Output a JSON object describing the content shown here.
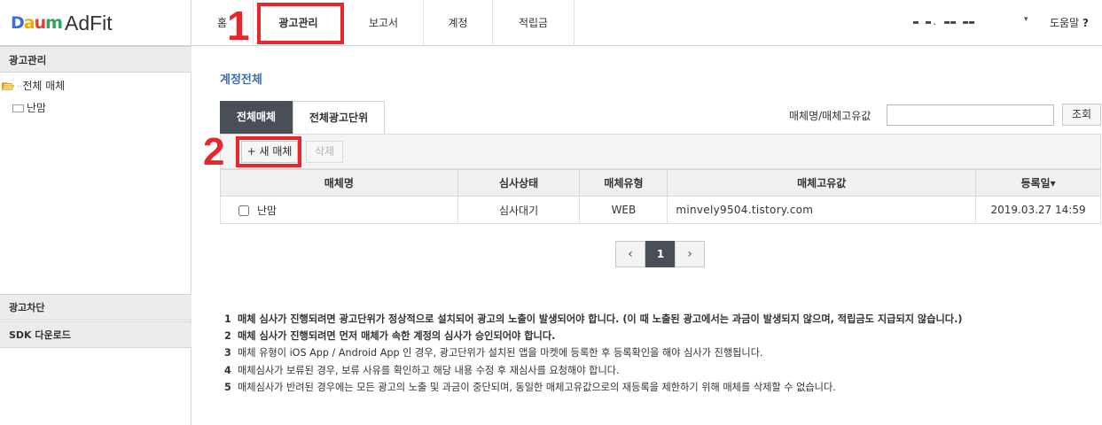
{
  "brand": {
    "daum_letters": [
      "D",
      "a",
      "u",
      "m"
    ],
    "daum_colors": [
      "#3d6fd8",
      "#f4a700",
      "#e33e2b",
      "#2da55b"
    ],
    "adfit": "AdFit"
  },
  "nav": {
    "items": [
      "홈",
      "광고관리",
      "보고서",
      "계정",
      "적립금"
    ],
    "active": "광고관리"
  },
  "user": {
    "name_masked": "▬ ▬. ▬▬ ▬▬",
    "caret": "▾"
  },
  "help": {
    "label": "도움말",
    "icon": "?"
  },
  "annotations": {
    "step1": "1",
    "step2": "2",
    "mark_color": "#e8262b"
  },
  "sidebar": {
    "section_title": "광고관리",
    "tree": [
      {
        "label": "전체 매체",
        "icon": "open-folder-icon"
      },
      {
        "label": "난맘",
        "icon": "folder-icon"
      }
    ],
    "bottom_sections": [
      "광고차단",
      "SDK 다운로드"
    ]
  },
  "main": {
    "title": "계정전체",
    "tabs": [
      "전체매체",
      "전체광고단위"
    ],
    "search": {
      "label": "매체명/매체고유값",
      "value": "",
      "button": "조회"
    },
    "toolbar": {
      "new_button": "+ 새 매체",
      "delete_button": "삭제"
    },
    "table": {
      "columns": [
        "매체명",
        "심사상태",
        "매체유형",
        "매체고유값",
        "등록일▾"
      ],
      "rows": [
        {
          "name": "난맘",
          "status": "심사대기",
          "type": "WEB",
          "id": "minvely9504.tistory.com",
          "date": "2019.03.27 14:59"
        }
      ]
    },
    "pagination": {
      "prev": "‹",
      "current": "1",
      "next": "›"
    },
    "notes": [
      {
        "n": "1",
        "text": "매체 심사가 진행되려면 광고단위가 정상적으로 설치되어 광고의 노출이 발생되어야 합니다. (이 때 노출된 광고에서는 과금이 발생되지 않으며, 적립금도 지급되지 않습니다.)",
        "bold": true
      },
      {
        "n": "2",
        "text": "매체 심사가 진행되려면 먼저 매체가 속한 계정의 심사가 승인되어야 합니다.",
        "bold": true
      },
      {
        "n": "3",
        "text": "매체 유형이 iOS App / Android App 인 경우, 광고단위가 설치된 앱을 마켓에 등록한 후 등록확인을 해야 심사가 진행됩니다.",
        "bold": false
      },
      {
        "n": "4",
        "text": "매체심사가 보류된 경우, 보류 사유를 확인하고 해당 내용 수정 후 재심사를 요청해야 합니다.",
        "bold": false
      },
      {
        "n": "5",
        "text": "매체심사가 반려된 경우에는 모든 광고의 노출 및 과금이 중단되며, 동일한 매체고유값으로의 재등록을 제한하기 위해 매체를 삭제할 수 없습니다.",
        "bold": false
      }
    ]
  }
}
